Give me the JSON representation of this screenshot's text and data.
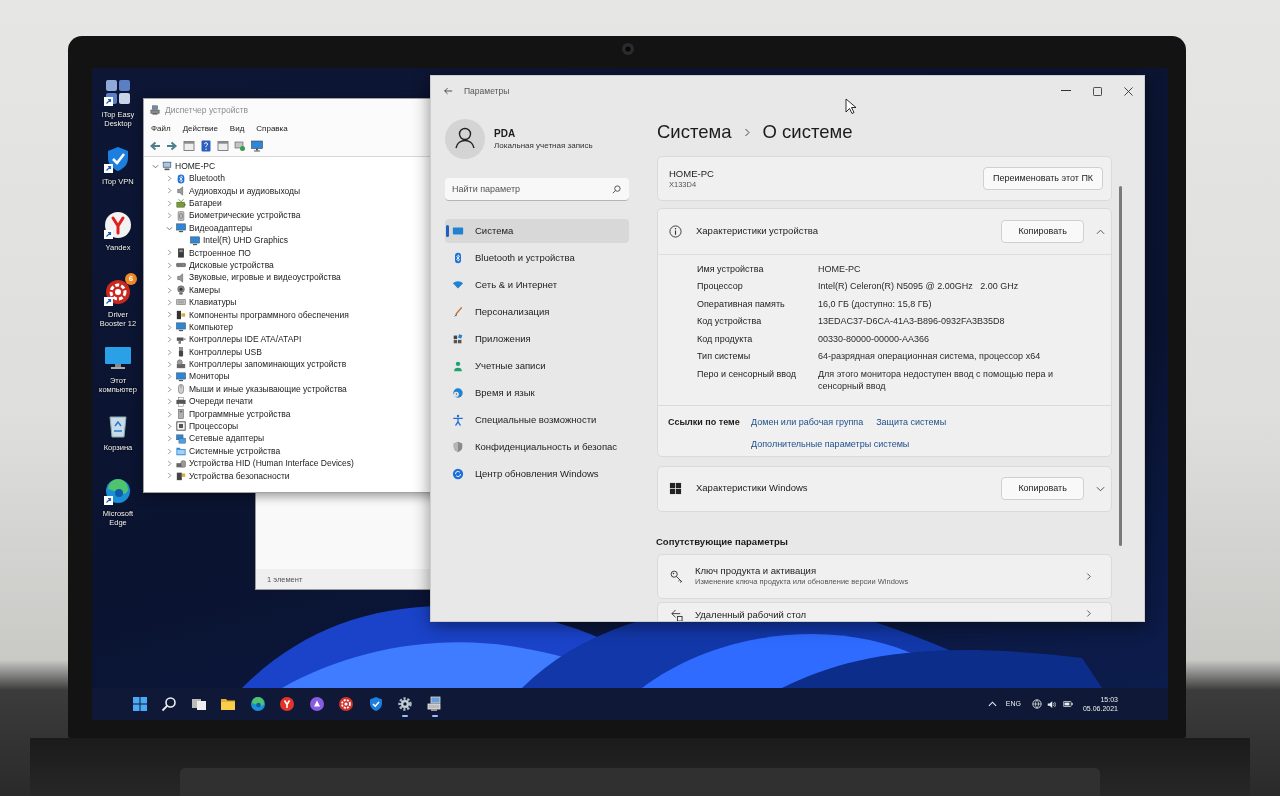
{
  "desktop": {
    "icons": [
      {
        "label": "iTop Easy Desktop",
        "kind": "itop-desktop",
        "shortcut": true
      },
      {
        "label": "iTop VPN",
        "kind": "vpn",
        "shortcut": true
      },
      {
        "label": "Yandex",
        "kind": "yandex",
        "shortcut": true
      },
      {
        "label": "Driver Booster 12",
        "kind": "driver-booster",
        "shortcut": true,
        "badge": "6"
      },
      {
        "label": "Этот компьютер",
        "kind": "this-pc",
        "shortcut": false
      },
      {
        "label": "Корзина",
        "kind": "recycle-bin",
        "shortcut": false
      },
      {
        "label": "Microsoft Edge",
        "kind": "edge",
        "shortcut": true
      }
    ]
  },
  "explorer": {
    "status": "1 элемент"
  },
  "device_manager": {
    "title": "Диспетчер устройств",
    "menu": [
      "Файл",
      "Действие",
      "Вид",
      "Справка"
    ],
    "toolbar": [
      {
        "kind": "back"
      },
      {
        "kind": "forward"
      },
      {
        "kind": "sheet"
      },
      {
        "kind": "help"
      },
      {
        "kind": "sheet"
      },
      {
        "kind": "scan"
      },
      {
        "kind": "monitor"
      }
    ],
    "tree": [
      {
        "label": "HOME-PC",
        "kind": "computer",
        "expanded": true,
        "children": [
          {
            "label": "Bluetooth",
            "kind": "bluetooth",
            "expanded": false
          },
          {
            "label": "Аудиовходы и аудиовыходы",
            "kind": "audio",
            "expanded": false
          },
          {
            "label": "Батареи",
            "kind": "battery",
            "expanded": false
          },
          {
            "label": "Биометрические устройства",
            "kind": "biometric",
            "expanded": false
          },
          {
            "label": "Видеоадаптеры",
            "kind": "display",
            "expanded": true,
            "children": [
              {
                "label": "Intel(R) UHD Graphics",
                "kind": "display"
              }
            ]
          },
          {
            "label": "Встроенное ПО",
            "kind": "firmware",
            "expanded": false
          },
          {
            "label": "Дисковые устройства",
            "kind": "disk",
            "expanded": false
          },
          {
            "label": "Звуковые, игровые и видеоустройства",
            "kind": "audio",
            "expanded": false
          },
          {
            "label": "Камеры",
            "kind": "camera",
            "expanded": false
          },
          {
            "label": "Клавиатуры",
            "kind": "keyboard",
            "expanded": false
          },
          {
            "label": "Компоненты программного обеспечения",
            "kind": "component",
            "expanded": false
          },
          {
            "label": "Компьютер",
            "kind": "display",
            "expanded": false
          },
          {
            "label": "Контроллеры IDE ATA/ATAPI",
            "kind": "ide",
            "expanded": false
          },
          {
            "label": "Контроллеры USB",
            "kind": "usb",
            "expanded": false
          },
          {
            "label": "Контроллеры запоминающих устройств",
            "kind": "storage",
            "expanded": false
          },
          {
            "label": "Мониторы",
            "kind": "display",
            "expanded": false
          },
          {
            "label": "Мыши и иные указывающие устройства",
            "kind": "mouse",
            "expanded": false
          },
          {
            "label": "Очереди печати",
            "kind": "printer",
            "expanded": false
          },
          {
            "label": "Программные устройства",
            "kind": "software",
            "expanded": false
          },
          {
            "label": "Процессоры",
            "kind": "processor",
            "expanded": false
          },
          {
            "label": "Сетевые адаптеры",
            "kind": "network",
            "expanded": false
          },
          {
            "label": "Системные устройства",
            "kind": "system",
            "expanded": false
          },
          {
            "label": "Устройства HID (Human Interface Devices)",
            "kind": "hid",
            "expanded": false
          },
          {
            "label": "Устройства безопасности",
            "kind": "security",
            "expanded": false
          }
        ]
      }
    ]
  },
  "settings": {
    "title": "Параметры",
    "account": {
      "name": "PDA",
      "type": "Локальная учетная запись"
    },
    "search": {
      "placeholder": "Найти параметр"
    },
    "nav": [
      {
        "label": "Система",
        "kind": "system",
        "selected": true
      },
      {
        "label": "Bluetooth и устройства",
        "kind": "bluetooth",
        "selected": false
      },
      {
        "label": "Сеть & и Интернет",
        "kind": "network",
        "selected": false
      },
      {
        "label": "Персонализация",
        "kind": "personalization",
        "selected": false
      },
      {
        "label": "Приложения",
        "kind": "apps",
        "selected": false
      },
      {
        "label": "Учетные записи",
        "kind": "accounts",
        "selected": false
      },
      {
        "label": "Время и язык",
        "kind": "time",
        "selected": false
      },
      {
        "label": "Специальные возможности",
        "kind": "accessibility",
        "selected": false
      },
      {
        "label": "Конфиденциальность и безопас",
        "kind": "privacy",
        "selected": false
      },
      {
        "label": "Центр обновления Windows",
        "kind": "update",
        "selected": false
      }
    ],
    "breadcrumb": [
      "Система",
      "О системе"
    ],
    "device": {
      "name": "HOME-PC",
      "model": "X133D4",
      "button": "Переименовать этот ПК"
    },
    "sections": [
      {
        "kind": "device",
        "title": "Характеристики устройства",
        "button": "Копировать",
        "expanded": true,
        "rows": [
          {
            "label": "Имя устройства",
            "value": "HOME-PC"
          },
          {
            "label": "Процессор",
            "value": "Intel(R) Celeron(R) N5095 @ 2.00GHz   2.00 GHz"
          },
          {
            "label": "Оперативная память",
            "value": "16,0 ГБ (доступно: 15,8 ГБ)"
          },
          {
            "label": "Код устройства",
            "value": "13EDAC37-D6CA-41A3-B896-0932FA3B35D8"
          },
          {
            "label": "Код продукта",
            "value": "00330-80000-00000-AA366"
          },
          {
            "label": "Тип системы",
            "value": "64-разрядная операционная система, процессор x64"
          },
          {
            "label": "Перо и сенсорный ввод",
            "value": "Для этого монитора недоступен ввод с помощью пера и сенсорный ввод"
          }
        ],
        "links_title": "Ссылки по теме",
        "links": [
          "Домен или рабочая группа",
          "Защита системы",
          "Дополнительные параметры системы"
        ]
      },
      {
        "kind": "windows",
        "title": "Характеристики Windows",
        "button": "Копировать",
        "expanded": false
      }
    ],
    "related": {
      "title": "Сопутствующие параметры",
      "items": [
        {
          "kind": "key",
          "title": "Ключ продукта и активация",
          "subtitle": "Изменение ключа продукта или обновление версии Windows"
        },
        {
          "kind": "remote",
          "title": "Удаленный рабочий стол"
        }
      ]
    }
  },
  "taskbar": {
    "apps": [
      {
        "kind": "start",
        "running": false
      },
      {
        "kind": "search",
        "running": false
      },
      {
        "kind": "task-view",
        "running": false
      },
      {
        "kind": "explorer",
        "running": false
      },
      {
        "kind": "edge",
        "running": false
      },
      {
        "kind": "yandex",
        "running": false
      },
      {
        "kind": "alice",
        "running": false
      },
      {
        "kind": "driver-booster",
        "running": false
      },
      {
        "kind": "vpn",
        "running": false
      },
      {
        "kind": "settings",
        "running": true
      },
      {
        "kind": "device-manager",
        "running": true
      }
    ],
    "tray": {
      "language": "ENG",
      "time": "15:03",
      "date": "05.06.2021"
    }
  }
}
